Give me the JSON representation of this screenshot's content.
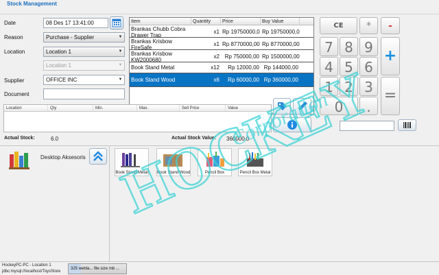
{
  "title": "Stock Management",
  "form": {
    "date_label": "Date",
    "date_value": "08 Des 17 13:41:00",
    "reason_label": "Reason",
    "reason_value": "Purchase - Supplier",
    "location_label": "Location",
    "location_value": "Location 1",
    "location2_value": "Location 1",
    "supplier_label": "Supplier",
    "supplier_value": "OFFICE INC",
    "document_label": "Document",
    "document_value": ""
  },
  "cart": {
    "columns": [
      "Item",
      "Quantity",
      "Price",
      "Buy Value"
    ],
    "rows": [
      {
        "item": "Brankas Chubb Cobra Drawer Trap",
        "qty": "x1",
        "price": "Rp 19750000,0",
        "buy": "Rp 19750000,0"
      },
      {
        "item": "Brankas Krisbow FireSafe",
        "qty": "x1",
        "price": "Rp 8770000,00",
        "buy": "Rp 8770000,00"
      },
      {
        "item": "Brankas Krisbow KW2000680",
        "qty": "x2",
        "price": "Rp 750000,00",
        "buy": "Rp 1500000,00"
      },
      {
        "item": "Book Stand Metal",
        "qty": "x12",
        "price": "Rp 12000,00",
        "buy": "Rp 144000,00"
      },
      {
        "item": "Book Stand Wood",
        "qty": "x6",
        "price": "Rp 60000,00",
        "buy": "Rp 360000,00"
      }
    ]
  },
  "keypad": {
    "ce": "CE",
    "mul": "*",
    "minus": "-",
    "plus": "+",
    "eq": "=",
    "dot": ".",
    "k7": "7",
    "k8": "8",
    "k9": "9",
    "k4": "4",
    "k5": "5",
    "k6": "6",
    "k1": "1",
    "k2": "2",
    "k3": "3",
    "k0": "0"
  },
  "grid2": {
    "columns": [
      "Location",
      "Qty",
      "Min.",
      "Max.",
      "Sell Price",
      "Value"
    ]
  },
  "stats": {
    "actual_stock_label": "Actual Stock:",
    "actual_stock_value": "6.0",
    "actual_value_label": "Actual Stock Value:",
    "actual_value_value": "360000.0"
  },
  "category": {
    "name": "Desktop Aksesoris"
  },
  "products": [
    {
      "name": "Book Stand Metal"
    },
    {
      "name": "Book Stand Wood"
    },
    {
      "name": "Pencil Box"
    },
    {
      "name": "Pencil Box Metal"
    }
  ],
  "status": {
    "line1": "HockeyPC-PC - Location 1",
    "line2": "jdbc:mysql://localhost/ToysStore",
    "memory": "325 webla... file size mb ..."
  },
  "watermark": {
    "line1": "HOCKEY",
    "line2": "Corporation"
  },
  "colors": {
    "selected_row": "#0a74c4",
    "title": "#1a6fc0",
    "watermark": "#3fd3d6"
  }
}
